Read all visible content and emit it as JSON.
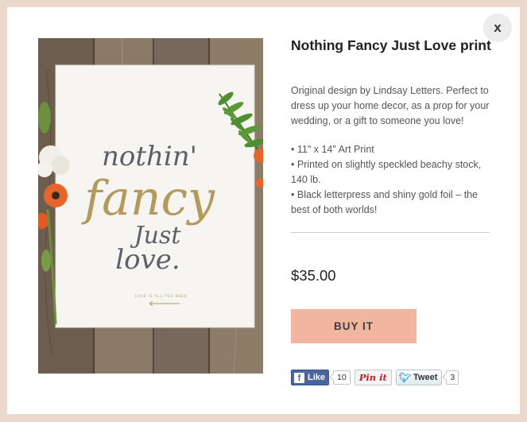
{
  "modal": {
    "close_label": "x"
  },
  "product": {
    "title": "Nothing Fancy Just Love print",
    "description": "Original design by Lindsay Letters. Perfect to dress up your home decor, as a prop for your wedding, or a gift to someone you love!",
    "features": [
      "11\" x 14\" Art Print",
      "Printed on slightly speckled beachy stock, 140 lb.",
      "Black letterpress and shiny gold foil – the best of both worlds!"
    ],
    "price": "$35.00",
    "buy_label": "BUY IT"
  },
  "print_art": {
    "line1": "nothin'",
    "line2": "fancy",
    "line3": "Just",
    "line4": "love.",
    "tagline": "LOVE IS ALL YOU NEED",
    "colors": {
      "gold": "#b39a5a",
      "ink": "#5a5f68",
      "paper": "#f6f5f1",
      "wood": "#7f6e5b",
      "flower_orange": "#e5652a",
      "fern": "#4f8f2f"
    }
  },
  "social": {
    "facebook": {
      "label": "Like",
      "count": "10",
      "icon": "facebook-icon"
    },
    "pinterest": {
      "label": "Pin it",
      "icon": "pinterest-icon"
    },
    "twitter": {
      "label": "Tweet",
      "count": "3",
      "icon": "twitter-bird-icon"
    }
  },
  "colors": {
    "background": "#ead9cc",
    "buy_button": "#f2b6a0",
    "facebook": "#4a66a0",
    "pinterest": "#cb2027",
    "twitter": "#2aa9e0"
  }
}
